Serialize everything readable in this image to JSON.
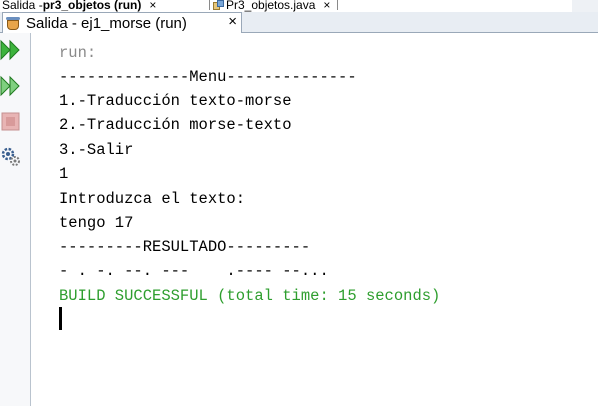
{
  "top_tabs": [
    {
      "label_prefix": "Salida - ",
      "label_bold": "pr3_objetos (run)",
      "close": "×"
    },
    {
      "label": "Pr3_objetos.java",
      "close": "×"
    }
  ],
  "output_tab": {
    "label": "Salida - ej1_morse (run)",
    "close": "×"
  },
  "toolbar": {
    "buttons": [
      "rerun-icon",
      "rerun-with-params-icon",
      "stop-icon",
      "settings-icon"
    ]
  },
  "console": {
    "lines": [
      "run:",
      "--------------Menu--------------",
      "1.-Traducción texto-morse",
      "2.-Traducción morse-texto",
      "3.-Salir",
      "1",
      "Introduzca el texto:",
      "tengo 17",
      "---------RESULTADO---------",
      "- . -. --. ---    .---- --...",
      "BUILD SUCCESSFUL (total time: 15 seconds)"
    ]
  },
  "colors": {
    "success": "#2e9e2e",
    "run_text": "#8a8a8a",
    "toolbar_green": "#3db33d",
    "stop_red": "#d89a9a"
  }
}
